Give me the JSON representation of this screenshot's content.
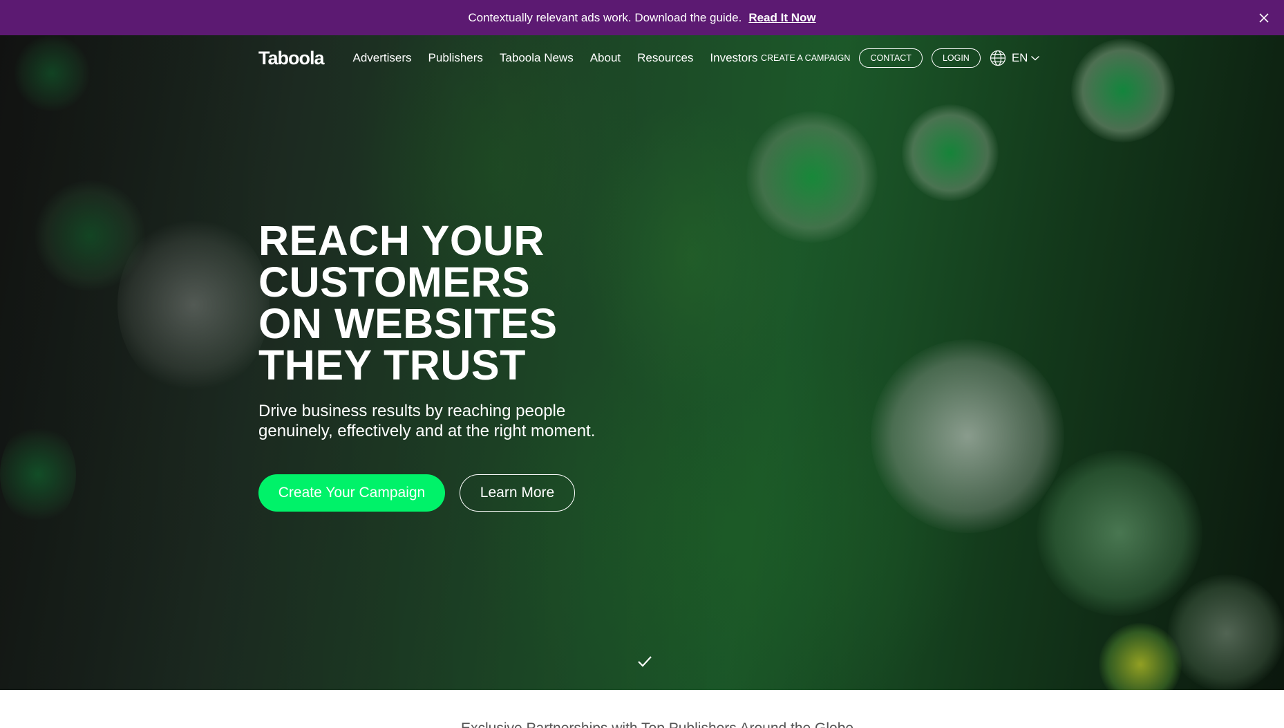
{
  "announcement": {
    "message": "Contextually relevant ads work. Download the guide.",
    "cta_label": "Read It Now",
    "close_icon": "close-icon",
    "background_color": "#5c1a72"
  },
  "nav": {
    "logo": "Taboola",
    "links": [
      "Advertisers",
      "Publishers",
      "Taboola News",
      "About",
      "Resources",
      "Investors"
    ],
    "create_campaign": "CREATE A CAMPAIGN",
    "contact": "CONTACT",
    "login": "LOGIN",
    "language": "EN",
    "globe_icon": "globe-icon",
    "chevron_icon": "chevron-down-icon"
  },
  "hero": {
    "headline_lines": [
      "REACH YOUR",
      "CUSTOMERS",
      "ON WEBSITES",
      "THEY TRUST"
    ],
    "subheadline_lines": [
      "Drive business results by reaching people",
      "genuinely, effectively and at the right moment."
    ],
    "primary_button": "Create Your Campaign",
    "secondary_button": "Learn More",
    "scroll_icon": "checkmark-icon",
    "accent_color": "#00f269"
  },
  "below_hero": {
    "partial_text": "Exclusive Partnerships with Top Publishers Around the Globe"
  }
}
